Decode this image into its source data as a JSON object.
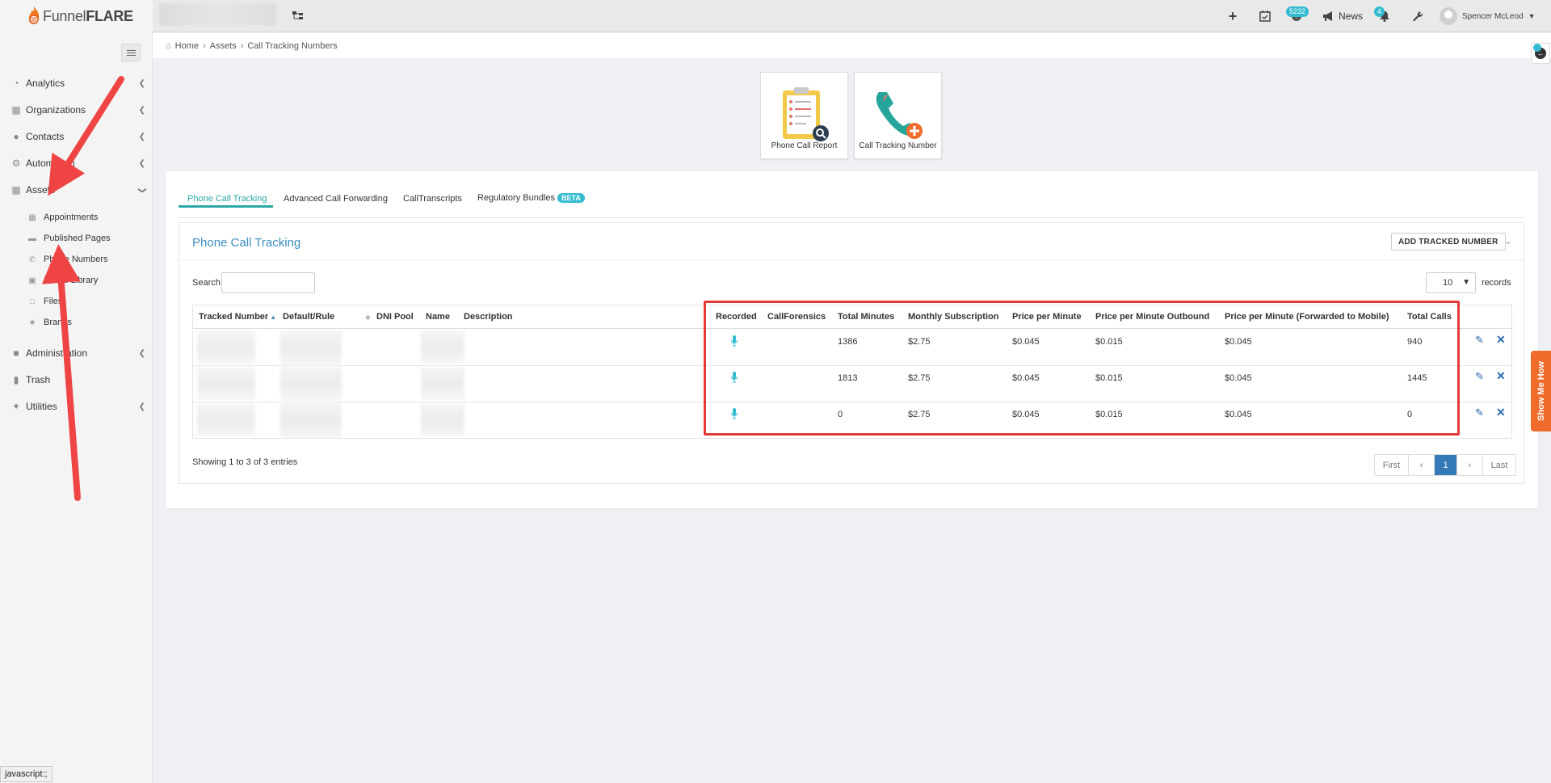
{
  "app": {
    "logo_text_a": "Funnel",
    "logo_text_b": "FLARE",
    "logo_tm": "®"
  },
  "topbar": {
    "notifications_count": "5232",
    "news_label": "News",
    "alerts_count": "4",
    "user_name": "Spencer McLeod"
  },
  "sidebar": {
    "items": [
      {
        "label": "Analytics",
        "icon": "dashboard-icon"
      },
      {
        "label": "Organizations",
        "icon": "sitemap-icon"
      },
      {
        "label": "Contacts",
        "icon": "users-icon"
      },
      {
        "label": "Automation",
        "icon": "cogs-icon"
      },
      {
        "label": "Assets",
        "icon": "grid-icon"
      },
      {
        "label": "Administration",
        "icon": "lock-icon"
      },
      {
        "label": "Trash",
        "icon": "trash-icon"
      },
      {
        "label": "Utilities",
        "icon": "wrench-icon"
      }
    ],
    "assets_sub": [
      {
        "label": "Appointments",
        "icon": "calendar-icon"
      },
      {
        "label": "Published Pages",
        "icon": "page-icon"
      },
      {
        "label": "Phone Numbers",
        "icon": "phone-icon"
      },
      {
        "label": "Image Library",
        "icon": "image-icon"
      },
      {
        "label": "Files",
        "icon": "file-icon"
      },
      {
        "label": "Brands",
        "icon": "star-icon"
      }
    ]
  },
  "status_bar": "javascript:;",
  "breadcrumb": {
    "home": "Home",
    "assets": "Assets",
    "current": "Call Tracking Numbers"
  },
  "tiles": {
    "report": "Phone Call Report",
    "tracking": "Call Tracking Number"
  },
  "tabs": {
    "t1": "Phone Call Tracking",
    "t2": "Advanced Call Forwarding",
    "t3": "CallTranscripts",
    "t4": "Regulatory Bundles",
    "beta": "BETA"
  },
  "section": {
    "title": "Phone Call Tracking",
    "add_button": "ADD TRACKED NUMBER"
  },
  "table_controls": {
    "search_label": "Search:",
    "page_length": "10",
    "records_label": "records"
  },
  "columns": {
    "tracked": "Tracked Number",
    "rule": "Default/Rule",
    "dni": "DNI Pool",
    "name": "Name",
    "description": "Description",
    "recorded": "Recorded",
    "forensics": "CallForensics",
    "minutes": "Total Minutes",
    "subscription": "Monthly Subscription",
    "ppm": "Price per Minute",
    "ppm_out": "Price per Minute Outbound",
    "ppm_fwd": "Price per Minute (Forwarded to Mobile)",
    "calls": "Total Calls"
  },
  "rows": [
    {
      "minutes": "1386",
      "subscription": "$2.75",
      "ppm": "$0.045",
      "ppm_out": "$0.015",
      "ppm_fwd": "$0.045",
      "calls": "940"
    },
    {
      "minutes": "1813",
      "subscription": "$2.75",
      "ppm": "$0.045",
      "ppm_out": "$0.015",
      "ppm_fwd": "$0.045",
      "calls": "1445"
    },
    {
      "minutes": "0",
      "subscription": "$2.75",
      "ppm": "$0.045",
      "ppm_out": "$0.015",
      "ppm_fwd": "$0.045",
      "calls": "0"
    }
  ],
  "footer": {
    "showing": "Showing 1 to 3 of 3 entries"
  },
  "pager": {
    "first": "First",
    "prev": "‹",
    "current": "1",
    "next": "›",
    "last": "Last"
  },
  "show_me_how": "Show Me How",
  "colors": {
    "accent": "#2ba7a7",
    "link": "#3d8fc0",
    "highlight": "#e53935",
    "badge": "#33bcd1",
    "orange": "#ef6c2c"
  }
}
